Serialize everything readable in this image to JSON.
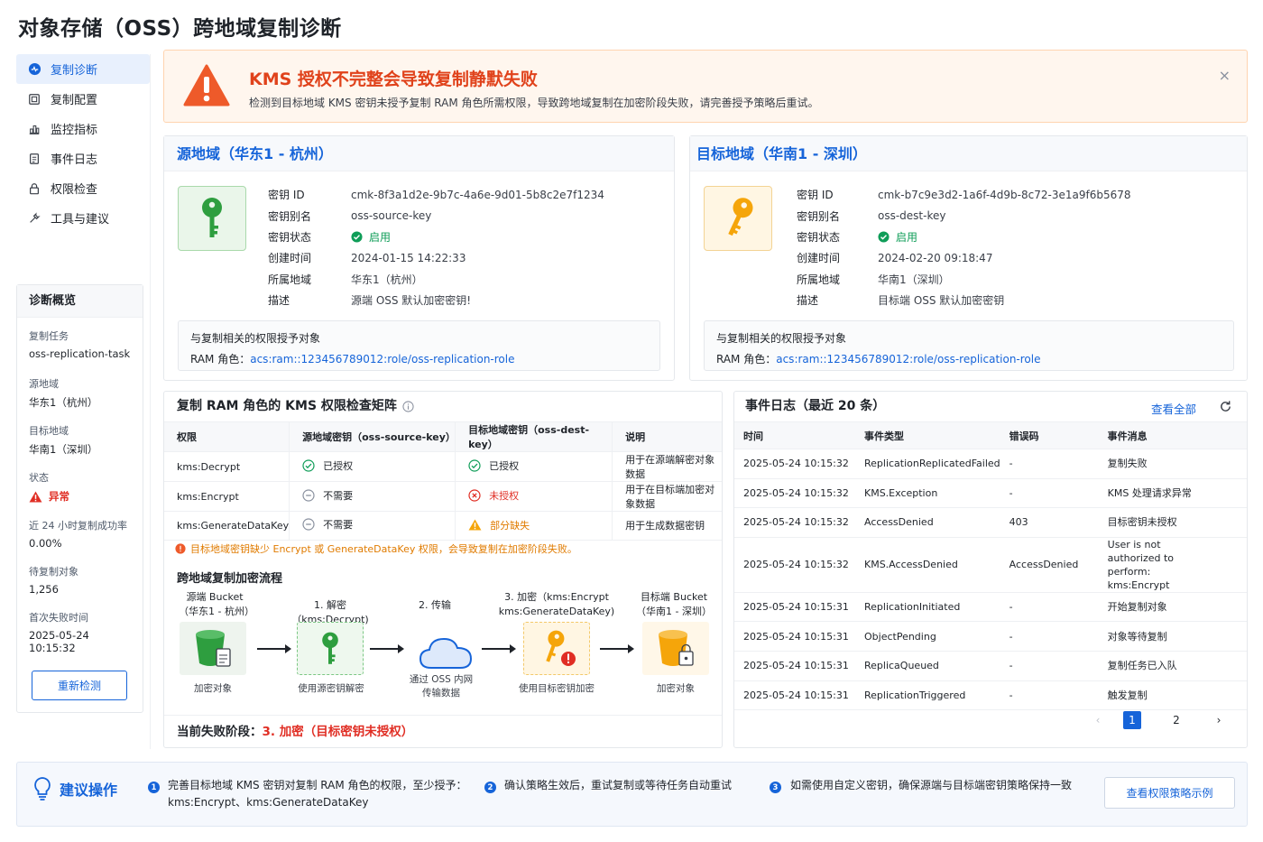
{
  "page": {
    "title": "对象存储（OSS）跨地域复制诊断"
  },
  "nav": {
    "items": [
      {
        "label": "复制诊断",
        "icon": "diagnose-icon",
        "active": true
      },
      {
        "label": "复制配置",
        "icon": "config-icon"
      },
      {
        "label": "监控指标",
        "icon": "chart-icon"
      },
      {
        "label": "事件日志",
        "icon": "log-icon"
      },
      {
        "label": "权限检查",
        "icon": "lock-icon"
      },
      {
        "label": "工具与建议",
        "icon": "tools-icon"
      }
    ]
  },
  "overview": {
    "title": "诊断概览",
    "items": [
      {
        "label": "复制任务",
        "value": "oss-replication-task"
      },
      {
        "label": "源地域",
        "value": "华东1（杭州）"
      },
      {
        "label": "目标地域",
        "value": "华南1（深圳）"
      },
      {
        "label": "状态",
        "value": "异常"
      },
      {
        "label": "近 24 小时复制成功率",
        "value": "0.00%"
      },
      {
        "label": "待复制对象",
        "value": "1,256"
      },
      {
        "label": "首次失败时间",
        "value": "2025-05-24 10:15:32"
      }
    ],
    "recheck_label": "重新检测"
  },
  "alert": {
    "title": "KMS 授权不完整会导致复制静默失败",
    "desc": "检测到目标地域 KMS 密钥未授予复制 RAM 角色所需权限，导致跨地域复制在加密阶段失败，请完善授予策略后重试。",
    "close": "×"
  },
  "source": {
    "title": "源地域（华东1 - 杭州）",
    "rows": [
      {
        "k": "密钥 ID",
        "v": "cmk-8f3a1d2e-9b7c-4a6e-9d01-5b8c2e7f1234"
      },
      {
        "k": "密钥别名",
        "v": "oss-source-key"
      },
      {
        "k": "密钥状态",
        "v": "启用"
      },
      {
        "k": "创建时间",
        "v": "2024-01-15 14:22:33"
      },
      {
        "k": "所属地域",
        "v": "华东1（杭州）"
      },
      {
        "k": "描述",
        "v": "源端 OSS 默认加密密钥!"
      }
    ],
    "perm_title": "与复制相关的权限授予对象",
    "role_label": "RAM 角色：",
    "role_value": "acs:ram::123456789012:role/oss-replication-role"
  },
  "target": {
    "title": "目标地域（华南1 - 深圳）",
    "rows": [
      {
        "k": "密钥 ID",
        "v": "cmk-b7c9e3d2-1a6f-4d9b-8c72-3e1a9f6b5678"
      },
      {
        "k": "密钥别名",
        "v": "oss-dest-key"
      },
      {
        "k": "密钥状态",
        "v": "启用"
      },
      {
        "k": "创建时间",
        "v": "2024-02-20 09:18:47"
      },
      {
        "k": "所属地域",
        "v": "华南1（深圳）"
      },
      {
        "k": "描述",
        "v": "目标端 OSS 默认加密密钥"
      }
    ],
    "perm_title": "与复制相关的权限授予对象",
    "role_label": "RAM 角色：",
    "role_value": "acs:ram::123456789012:role/oss-replication-role"
  },
  "matrix": {
    "title": "复制 RAM 角色的 KMS 权限检查矩阵",
    "headers": [
      "权限",
      "源地域密钥（oss-source-key）",
      "目标地域密钥（oss-dest-key）",
      "说明"
    ],
    "rows": [
      {
        "perm": "kms:Decrypt",
        "src": "已授权",
        "dst": "已授权",
        "note": "用于在源端解密对象数据"
      },
      {
        "perm": "kms:Encrypt",
        "src": "不需要",
        "dst": "未授权",
        "note": "用于在目标端加密对象数据"
      },
      {
        "perm": "kms:GenerateDataKey",
        "src": "不需要",
        "dst": "部分缺失",
        "note": "用于生成数据密钥"
      }
    ],
    "note": "目标地域密钥缺少 Encrypt 或 GenerateDataKey 权限，会导致复制在加密阶段失败。",
    "flow_title": "跨地域复制加密流程",
    "flow": {
      "src_bucket": "源端 Bucket",
      "src_region": "（华东1 - 杭州）",
      "step1": "1. 解密（kms:Decrypt)",
      "step2": "2. 传输",
      "step3a": "3. 加密（kms:Encrypt",
      "step3b": "kms:GenerateDataKey)",
      "dst_bucket": "目标端 Bucket",
      "dst_region": "（华南1 - 深圳）",
      "cap1": "加密对象",
      "cap2": "使用源密钥解密",
      "cap3a": "通过 OSS 内网",
      "cap3b": "传输数据",
      "cap4": "使用目标密钥加密",
      "cap5": "加密对象"
    },
    "fail_label": "当前失败阶段：",
    "fail_value": "3. 加密（目标密钥未授权）"
  },
  "events": {
    "title": "事件日志（最近 20 条）",
    "more": "查看全部",
    "headers": [
      "时间",
      "事件类型",
      "错误码",
      "事件消息"
    ],
    "rows": [
      {
        "time": "2025-05-24 10:15:32",
        "type": "ReplicationReplicatedFailed",
        "code": "-",
        "msg": "复制失败",
        "err": true
      },
      {
        "time": "2025-05-24 10:15:32",
        "type": "KMS.Exception",
        "code": "-",
        "msg": "KMS 处理请求异常",
        "err": true
      },
      {
        "time": "2025-05-24 10:15:32",
        "type": "AccessDenied",
        "code": "403",
        "msg": "目标密钥未授权",
        "err": true,
        "msgErr": true
      },
      {
        "time": "2025-05-24 10:15:32",
        "type": "KMS.AccessDenied",
        "code": "AccessDenied",
        "msg": "User is not authorized to perform: kms:Encrypt",
        "err": true,
        "msgErr": true
      },
      {
        "time": "2025-05-24 10:15:31",
        "type": "ReplicationInitiated",
        "code": "-",
        "msg": "开始复制对象"
      },
      {
        "time": "2025-05-24 10:15:31",
        "type": "ObjectPending",
        "code": "-",
        "msg": "对象等待复制"
      },
      {
        "time": "2025-05-24 10:15:31",
        "type": "ReplicaQueued",
        "code": "-",
        "msg": "复制任务已入队"
      },
      {
        "time": "2025-05-24 10:15:31",
        "type": "ReplicationTriggered",
        "code": "-",
        "msg": "触发复制"
      }
    ],
    "pager": {
      "prev": "‹",
      "pages": [
        "1",
        "2"
      ],
      "next": "›"
    }
  },
  "suggest": {
    "title": "建议操作",
    "items": [
      {
        "n": "1",
        "text": "完善目标地域 KMS 密钥对复制 RAM 角色的权限，至少授予：",
        "text2": "kms:Encrypt、kms:GenerateDataKey"
      },
      {
        "n": "2",
        "text": "确认策略生效后，重试复制或等待任务自动重试"
      },
      {
        "n": "3",
        "text": "如需使用自定义密钥，确保源端与目标端密钥策略保持一致"
      }
    ],
    "button": "查看权限策略示例"
  },
  "colors": {
    "brand": "#1664d9",
    "error": "#e02e24",
    "warning": "#e07b00",
    "success": "#0f9d58"
  }
}
